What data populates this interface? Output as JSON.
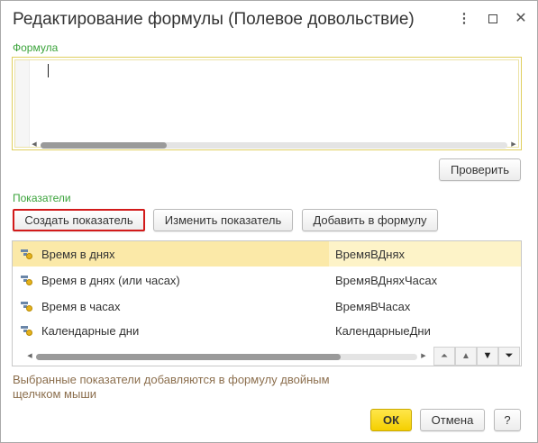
{
  "window": {
    "title": "Редактирование формулы (Полевое довольствие)",
    "more_icon": "⋮",
    "close_icon": "✕"
  },
  "formula": {
    "label": "Формула",
    "value": "",
    "scroll_position": 0.27,
    "check_button": "Проверить"
  },
  "indicators": {
    "label": "Показатели",
    "create_button": "Создать показатель",
    "edit_button": "Изменить показатель",
    "add_button": "Добавить в формулу",
    "rows": [
      {
        "name": "Время в днях",
        "code": "ВремяВДнях",
        "selected": true
      },
      {
        "name": "Время в днях (или часах)",
        "code": "ВремяВДняхЧасах",
        "selected": false
      },
      {
        "name": "Время в часах",
        "code": "ВремяВЧасах",
        "selected": false
      },
      {
        "name": "Календарные дни",
        "code": "КалендарныеДни",
        "selected": false
      }
    ],
    "scroll_position": 0.8,
    "nav_icons": [
      "⏶",
      "▲",
      "▼",
      "⏷"
    ]
  },
  "hint_text": "Выбранные показатели добавляются в формулу двойным щелчком мыши",
  "footer": {
    "ok": "ОК",
    "cancel": "Отмена",
    "help": "?"
  },
  "colors": {
    "accent_green": "#3aa33a",
    "ok_yellow": "#f5cf00",
    "highlight_red": "#d21a1a",
    "selected_row": "#fbe9a8"
  }
}
